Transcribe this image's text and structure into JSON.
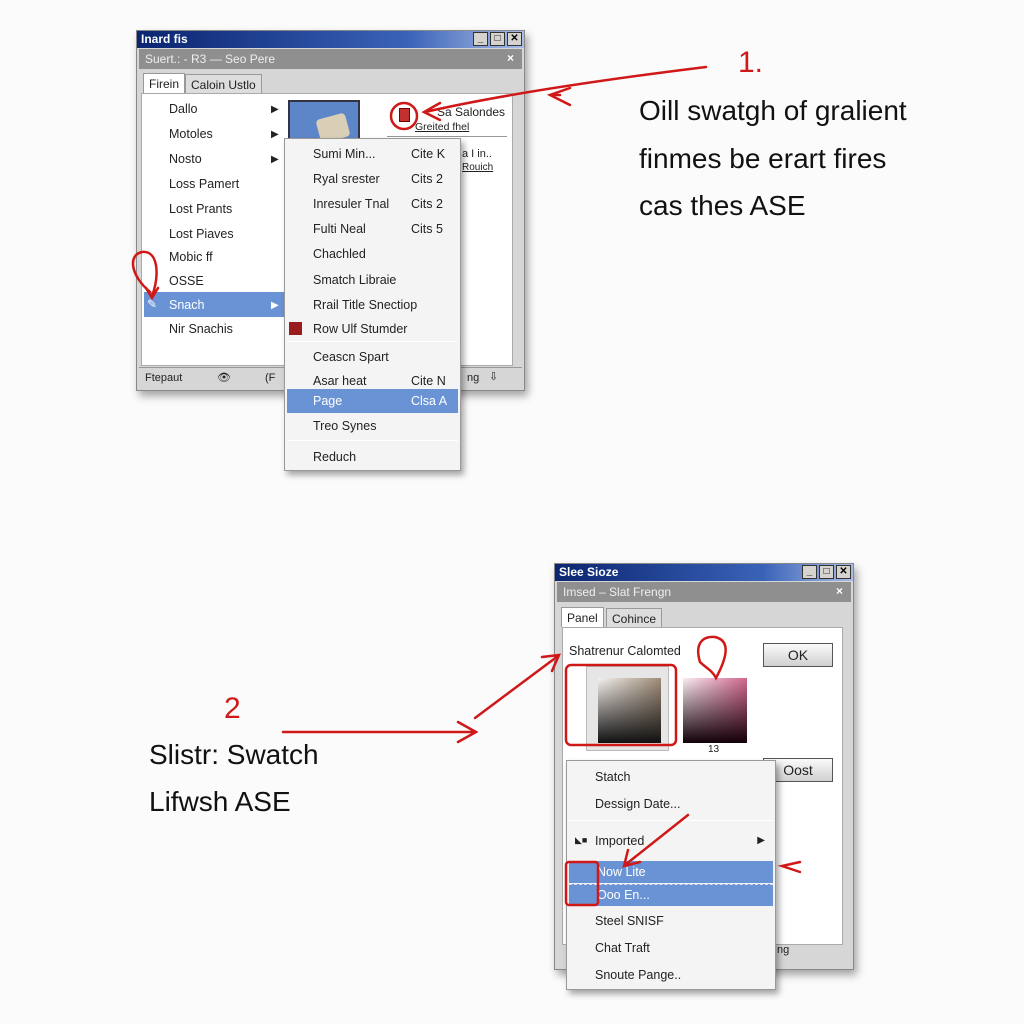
{
  "window1": {
    "title": "Inard fis",
    "subtitle": "Suert.: - R3 — Seo Pere",
    "tabs": [
      "Firein",
      "Caloin Ustlo"
    ],
    "list": [
      "Dallo",
      "Motoles",
      "Nosto",
      "Loss Pamert",
      "Lost Prants",
      "Lost Piaves",
      "Mobic ff",
      "OSSE",
      "Snach",
      "Nir Snachis"
    ],
    "submenu_items": [
      "Dallo",
      "Motoles",
      "Nosto",
      "Snach"
    ],
    "selected": "Snach",
    "side_label": "Sa Salondes",
    "side_link": "Greited fhel",
    "side_label2": "a I in..",
    "side_link2": "Rouich",
    "status": [
      "Ftepaut",
      "(F",
      "ng"
    ]
  },
  "menu1": {
    "items": [
      {
        "label": "Sumi Min...",
        "shortcut": "Cite K"
      },
      {
        "label": "Ryal srester",
        "shortcut": "Cits 2"
      },
      {
        "label": "Inresuler Tnal",
        "shortcut": "Cits 2"
      },
      {
        "label": "Fulti Neal",
        "shortcut": "Cits 5"
      },
      {
        "label": "Chachled",
        "shortcut": ""
      },
      {
        "label": "Smatch Libraie",
        "shortcut": ""
      },
      {
        "label": "Rrail Title Snectiop",
        "shortcut": ""
      },
      {
        "label": "Row Ulf Stumder",
        "shortcut": ""
      },
      {
        "label": "Ceascn Spart",
        "shortcut": ""
      },
      {
        "label": "Asar heat",
        "shortcut": "Cite N"
      },
      {
        "label": "Page",
        "shortcut": "Clsa A"
      },
      {
        "label": "Treo Synes",
        "shortcut": ""
      },
      {
        "label": "Reduch",
        "shortcut": ""
      }
    ],
    "highlighted": "Page"
  },
  "annotation1": {
    "number": "1.",
    "lines": [
      "Oill swatgh of gralient",
      "finmes be erart fires",
      "cas thes ASE"
    ]
  },
  "window2": {
    "title": "Slee Sioze",
    "subtitle": "Imsed – Slat Frengn",
    "tabs": [
      "Panel",
      "Cohince"
    ],
    "heading": "Shatrenur Calomted",
    "ok_label": "OK",
    "cost_label": "Oost",
    "swatch_value": "13",
    "status": "ng"
  },
  "menu2": {
    "items": [
      "Statch",
      "Dessign Date...",
      "Imported",
      "Now Lite",
      "Ooo En...",
      "Steel SNISF",
      "Chat Traft",
      "Snoute Pange.."
    ],
    "highlighted": [
      "Now Lite",
      "Ooo En..."
    ]
  },
  "annotation2": {
    "number": "2",
    "lines": [
      "Slistr: Swatch",
      "Lifwsh ASE"
    ]
  },
  "colors": {
    "accent_red": "#d01818",
    "highlight": "#6a93d6",
    "titlebar": "#0a2470"
  }
}
